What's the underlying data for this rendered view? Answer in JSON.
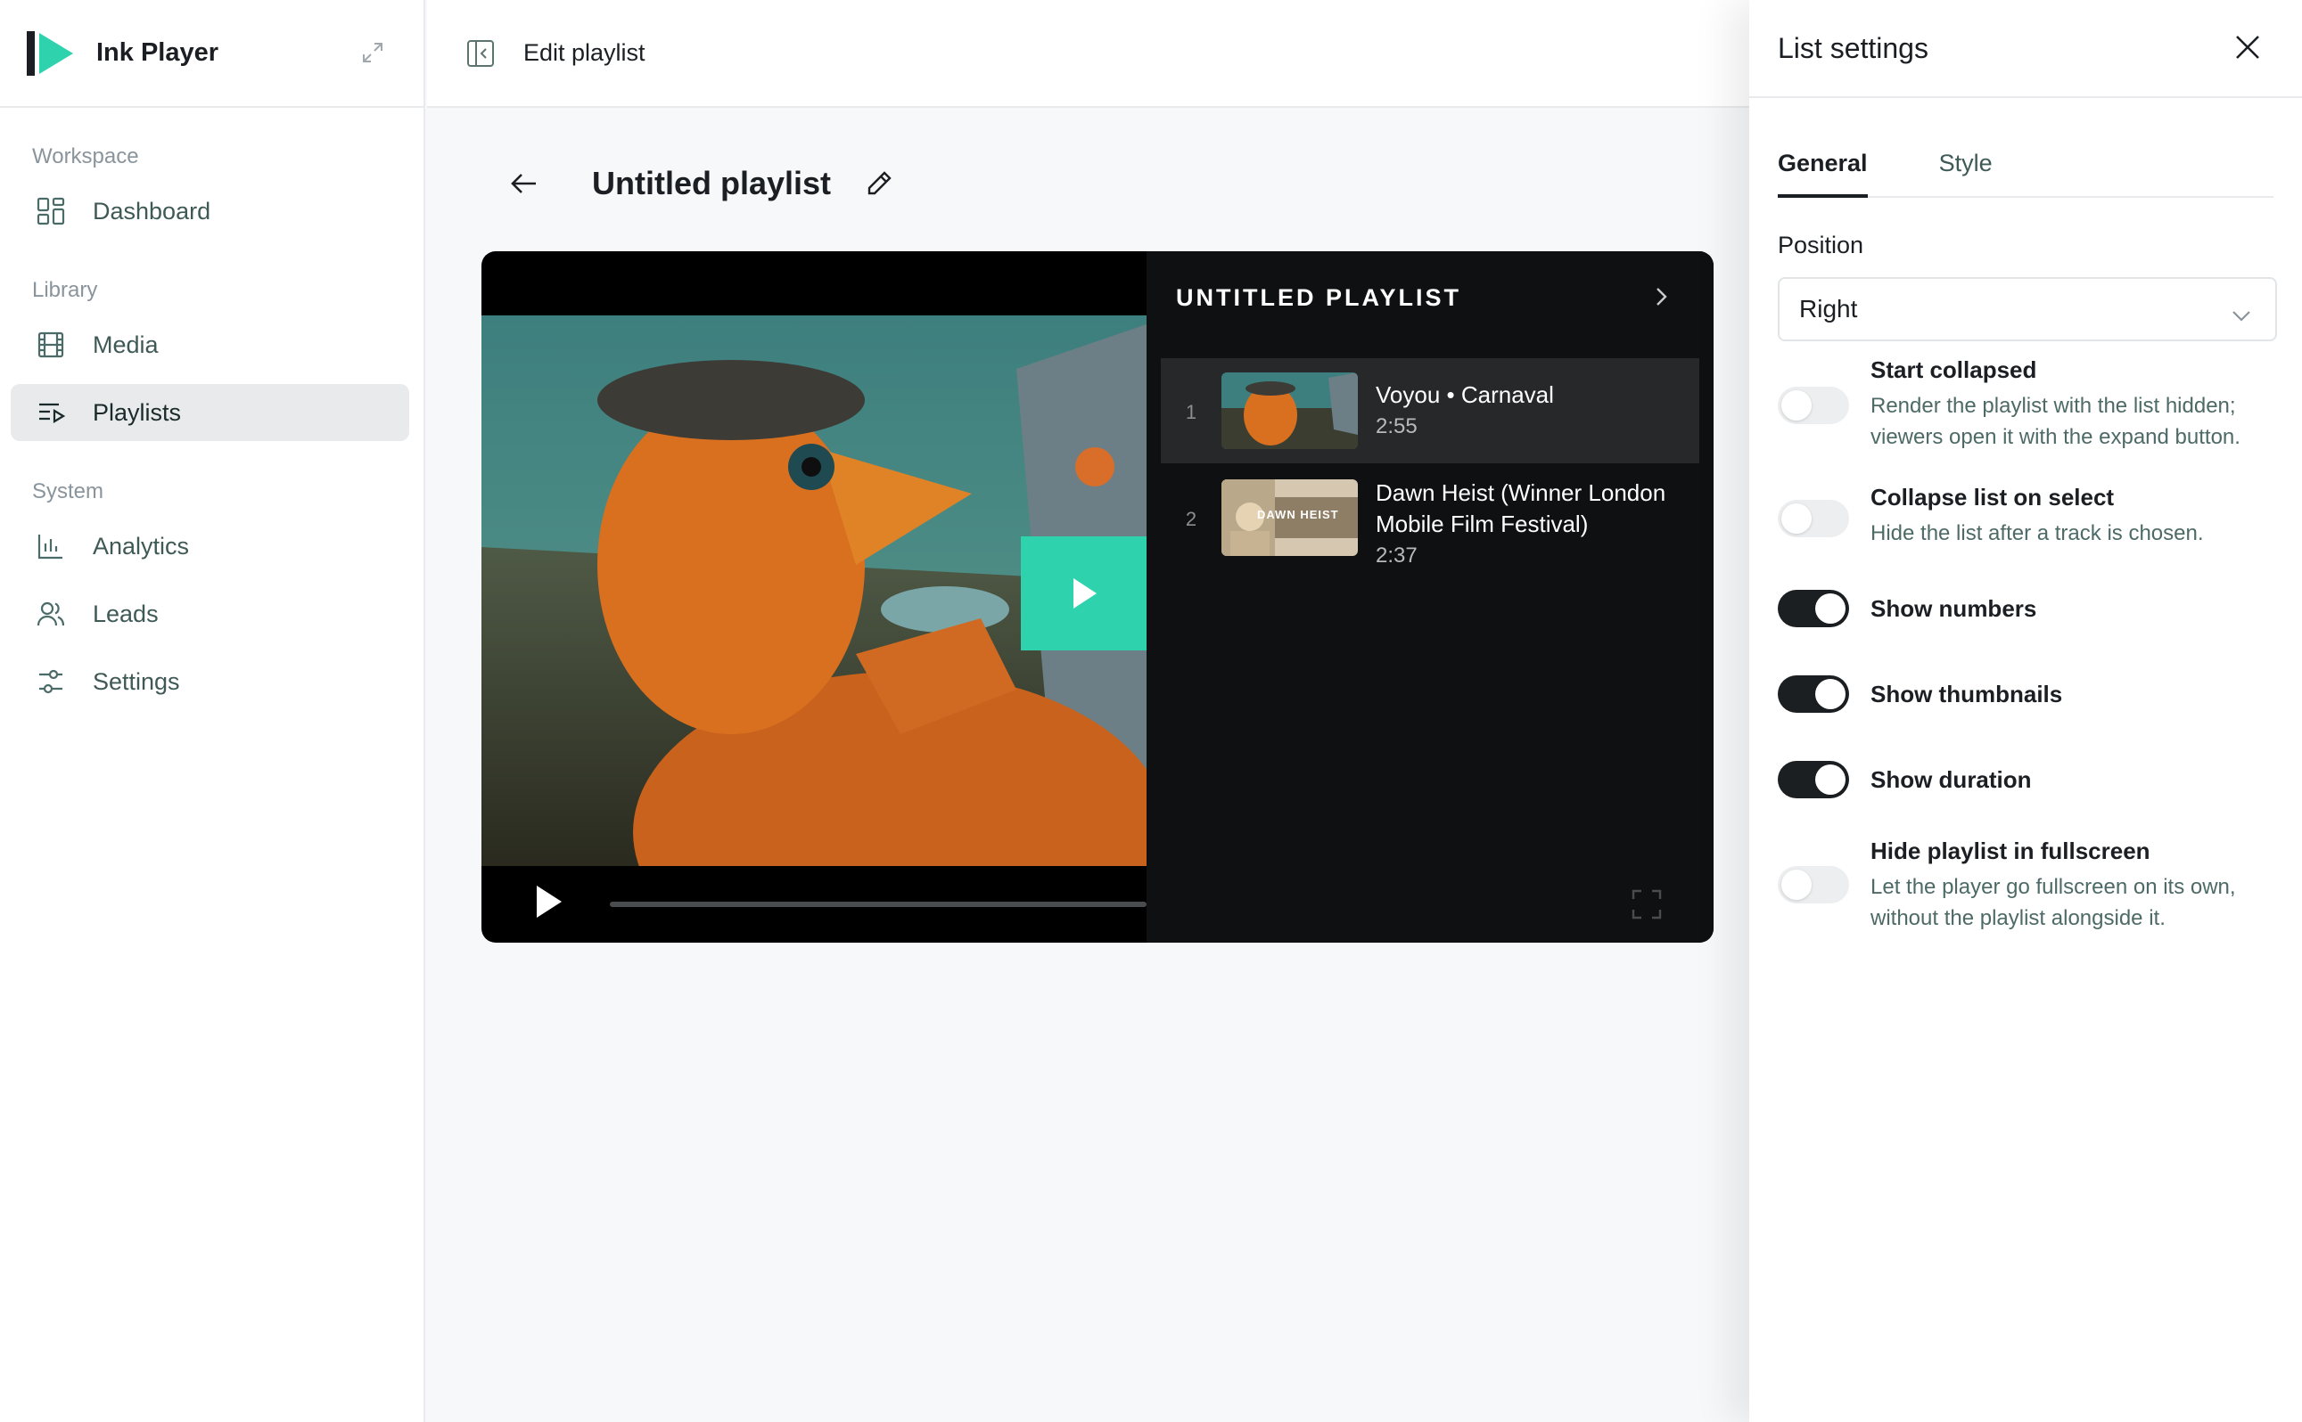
{
  "app": {
    "name": "Ink Player"
  },
  "sidebar": {
    "sections": [
      {
        "label": "Workspace",
        "items": [
          {
            "label": "Dashboard",
            "icon": "dashboard-icon"
          }
        ]
      },
      {
        "label": "Library",
        "items": [
          {
            "label": "Media",
            "icon": "film-icon"
          },
          {
            "label": "Playlists",
            "icon": "playlist-icon",
            "active": true
          }
        ]
      },
      {
        "label": "System",
        "items": [
          {
            "label": "Analytics",
            "icon": "bar-chart-icon"
          },
          {
            "label": "Leads",
            "icon": "users-icon"
          },
          {
            "label": "Settings",
            "icon": "sliders-icon"
          }
        ]
      }
    ]
  },
  "topbar": {
    "title": "Edit playlist"
  },
  "page": {
    "title": "Untitled playlist"
  },
  "player": {
    "playlist_title": "UNTITLED PLAYLIST",
    "tracks": [
      {
        "number": "1",
        "title": "Voyou • Carnaval",
        "duration": "2:55",
        "selected": true
      },
      {
        "number": "2",
        "title": "Dawn Heist (Winner London Mobile Film Festival)",
        "duration": "2:37",
        "thumb_text": "DAWN HEIST"
      }
    ],
    "accent": "#2ed3ae"
  },
  "panel": {
    "title": "List settings",
    "tabs": [
      "General",
      "Style"
    ],
    "active_tab": "General",
    "position_label": "Position",
    "position_value": "Right",
    "options": [
      {
        "title": "Start collapsed",
        "desc": "Render the playlist with the list hidden; viewers open it with the expand button.",
        "on": false
      },
      {
        "title": "Collapse list on select",
        "desc": "Hide the list after a track is chosen.",
        "on": false
      },
      {
        "title": "Show numbers",
        "desc": "",
        "on": true
      },
      {
        "title": "Show thumbnails",
        "desc": "",
        "on": true
      },
      {
        "title": "Show duration",
        "desc": "",
        "on": true
      },
      {
        "title": "Hide playlist in fullscreen",
        "desc": "Let the player go fullscreen on its own, without the playlist alongside it.",
        "on": false
      }
    ]
  }
}
